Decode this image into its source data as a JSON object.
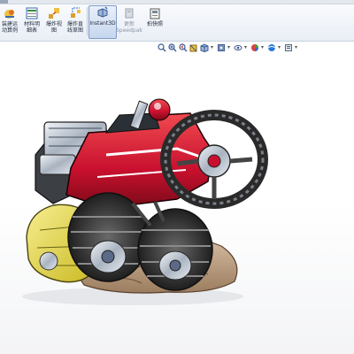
{
  "ribbon": {
    "buttons": [
      {
        "id": "b1",
        "label1": "装建运",
        "label2": "动算例",
        "icon": "motion-study-icon"
      },
      {
        "id": "b2",
        "label1": "材料明",
        "label2": "细表",
        "icon": "bom-icon"
      },
      {
        "id": "b3",
        "label1": "爆炸视",
        "label2": "图",
        "icon": "exploded-view-icon"
      },
      {
        "id": "b4",
        "label1": "爆炸直",
        "label2": "线草图",
        "icon": "explode-line-sketch-icon"
      },
      {
        "id": "b5",
        "label1": "Instant3D",
        "label2": "",
        "icon": "instant3d-icon",
        "active": true
      },
      {
        "id": "b6",
        "label1": "更新",
        "label2": "Speedpak",
        "icon": "speedpak-icon",
        "disabled": true
      },
      {
        "id": "b7",
        "label1": "拍快照",
        "label2": "",
        "icon": "snapshot-icon"
      }
    ]
  },
  "hud": {
    "icons": [
      "zoom-to-fit-icon",
      "zoom-area-icon",
      "previous-view-icon",
      "section-view-icon",
      "view-orientation-icon",
      "display-style-icon",
      "hide-show-items-icon",
      "edit-appearance-icon",
      "apply-scene-icon",
      "view-settings-icon"
    ]
  },
  "colors": {
    "accent": "#c8102e",
    "body_red": "#d21f2a",
    "tire": "#3a3a3a",
    "rock": "#c9a98a",
    "yellow": "#e8d84a"
  }
}
